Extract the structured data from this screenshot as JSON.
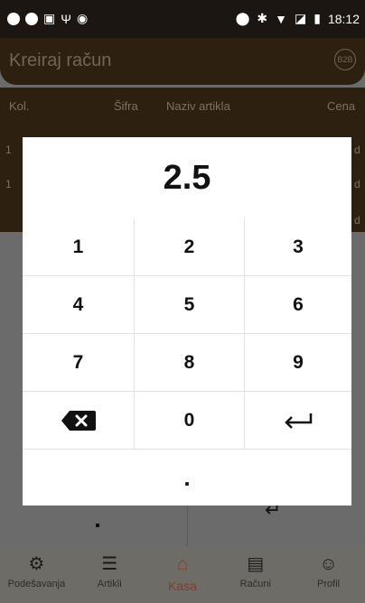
{
  "status_bar": {
    "time": "18:12"
  },
  "app_bar": {
    "title": "Kreiraj račun",
    "badge": "B2B"
  },
  "table": {
    "headers": [
      "Kol.",
      "Šifra",
      "Naziv artikla",
      "Cena"
    ],
    "rows": [
      {
        "qty": "1",
        "tail": "d"
      },
      {
        "qty": "1",
        "tail": "d"
      },
      {
        "qty": "",
        "tail": "d"
      }
    ]
  },
  "keypad": {
    "display_value": "2.5",
    "keys": [
      "1",
      "2",
      "3",
      "4",
      "5",
      "6",
      "7",
      "8",
      "9",
      "0",
      "."
    ]
  },
  "bottom_nav": {
    "items": [
      {
        "label": "Podešavanja",
        "icon": "settings-gear-icon"
      },
      {
        "label": "Artikli",
        "icon": "list-icon"
      },
      {
        "label": "Kasa",
        "icon": "home-icon",
        "active": true
      },
      {
        "label": "Računi",
        "icon": "receipt-icon"
      },
      {
        "label": "Profil",
        "icon": "profile-icon"
      }
    ]
  },
  "colors": {
    "brand": "#2e2011",
    "accent": "#8a3a2a",
    "overlay": "#6b6b6b"
  }
}
